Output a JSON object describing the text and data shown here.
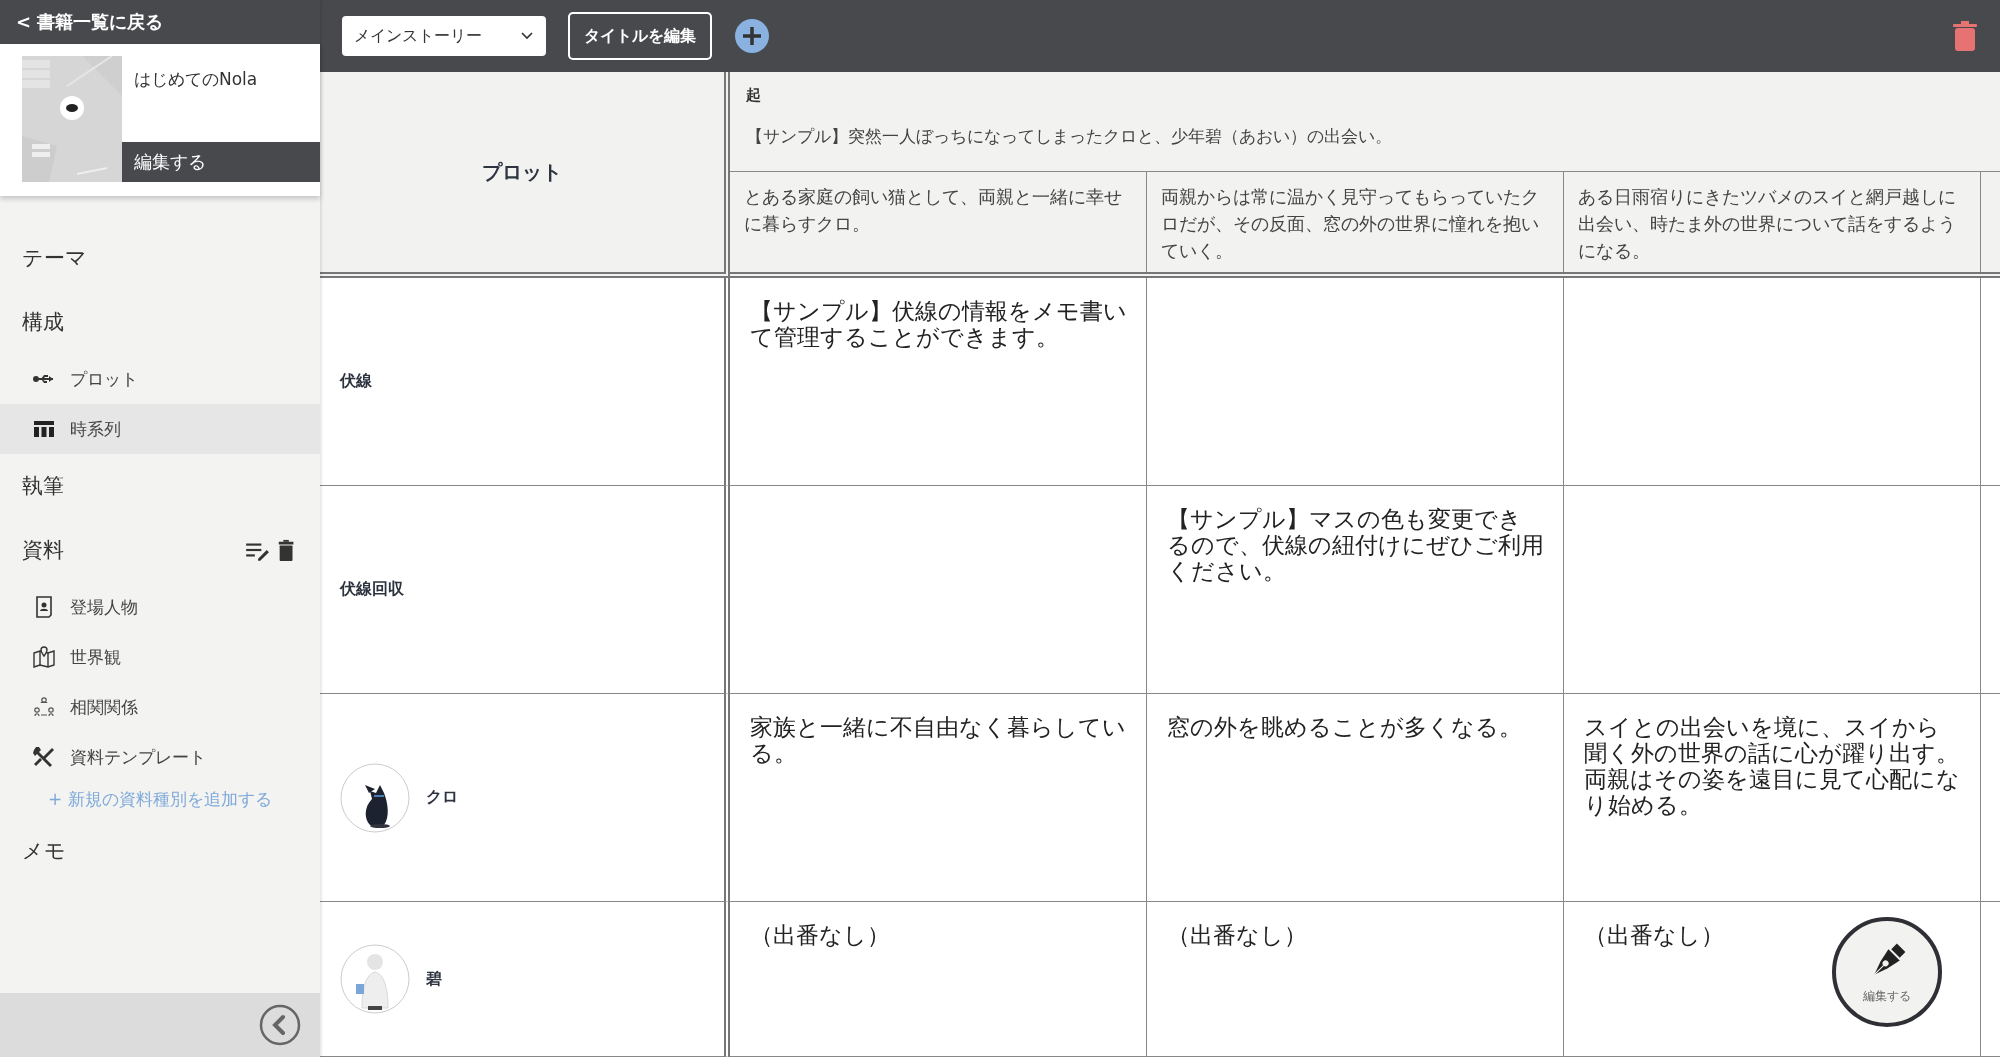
{
  "sidebar": {
    "back_link": "< 書籍一覧に戻る",
    "book": {
      "title": "はじめてのNola",
      "edit_label": "編集する"
    },
    "sections": [
      {
        "label": "テーマ"
      },
      {
        "label": "構成",
        "items": [
          {
            "label": "プロット",
            "selected": false
          },
          {
            "label": "時系列",
            "selected": true
          }
        ]
      },
      {
        "label": "執筆"
      },
      {
        "label": "資料",
        "has_actions": true,
        "items": [
          {
            "label": "登場人物",
            "selected": false
          },
          {
            "label": "世界観",
            "selected": false
          },
          {
            "label": "相関関係",
            "selected": false
          },
          {
            "label": "資料テンプレート",
            "selected": false
          }
        ],
        "add_link": "+ 新規の資料種別を追加する"
      },
      {
        "label": "メモ"
      }
    ]
  },
  "toolbar": {
    "story_select": {
      "value": "メインストーリー"
    },
    "edit_title_button": "タイトルを編集"
  },
  "table": {
    "corner_label": "プロット",
    "act": {
      "title": "起",
      "summary": "【サンプル】突然一人ぼっちになってしまったクロと、少年碧（あおい）の出会い。"
    },
    "columns": [
      {
        "text": "とある家庭の飼い猫として、両親と一緒に幸せに暮らすクロ。"
      },
      {
        "text": "両親からは常に温かく見守ってもらっていたクロだが、その反面、窓の外の世界に憧れを抱いていく。"
      },
      {
        "text": "ある日雨宿りにきたツバメのスイと網戸越しに出会い、時たま外の世界について話をするようになる。"
      }
    ],
    "rows": [
      {
        "kind": "plain",
        "label": "伏線",
        "cells": [
          "【サンプル】伏線の情報をメモ書いて管理することができます。",
          "",
          ""
        ]
      },
      {
        "kind": "plain",
        "label": "伏線回収",
        "cells": [
          "",
          "【サンプル】マスの色も変更できるので、伏線の紐付けにぜひご利用ください。",
          ""
        ]
      },
      {
        "kind": "character",
        "label": "クロ",
        "cells": [
          "家族と一緒に不自由なく暮らしている。",
          "窓の外を眺めることが多くなる。",
          "スイとの出会いを境に、スイから聞く外の世界の話に心が躍り出す。両親はその姿を遠目に見て心配になり始める。"
        ]
      },
      {
        "kind": "character",
        "label": "碧",
        "cells": [
          "（出番なし）",
          "（出番なし）",
          "（出番なし）"
        ]
      }
    ]
  },
  "fab": {
    "label": "編集する"
  }
}
